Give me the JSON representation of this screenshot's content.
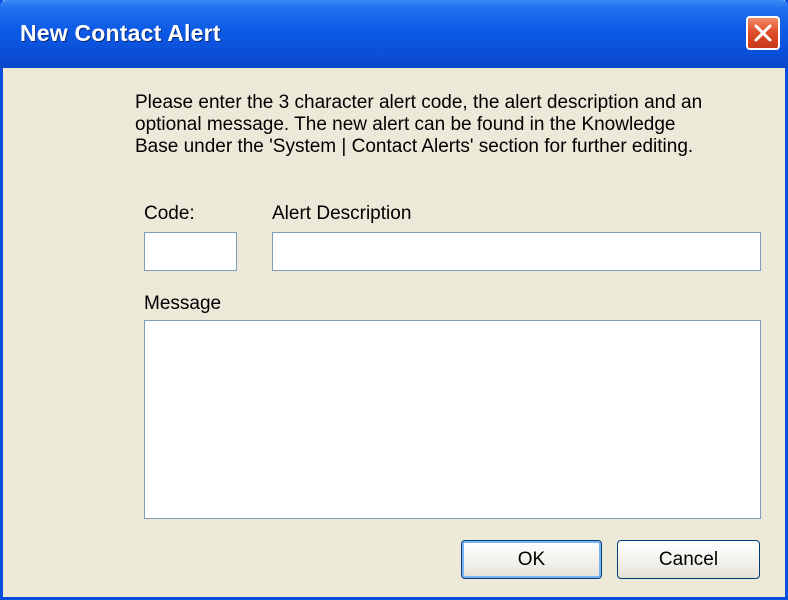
{
  "window": {
    "title": "New Contact Alert"
  },
  "instructions": "Please enter the 3 character alert code, the alert description and an\noptional message.  The new alert can be found in the Knowledge\nBase under the 'System | Contact Alerts' section for further editing.",
  "form": {
    "code_label": "Code:",
    "code_value": "",
    "description_label": "Alert Description",
    "description_value": "",
    "message_label": "Message",
    "message_value": ""
  },
  "buttons": {
    "ok_label": "OK",
    "cancel_label": "Cancel"
  },
  "icons": {
    "close": "close-icon"
  },
  "colors": {
    "titlebar": "#0a4fd8",
    "close_button": "#e0502a",
    "dialog_background": "#ece9d8",
    "field_border": "#7f9db9"
  }
}
